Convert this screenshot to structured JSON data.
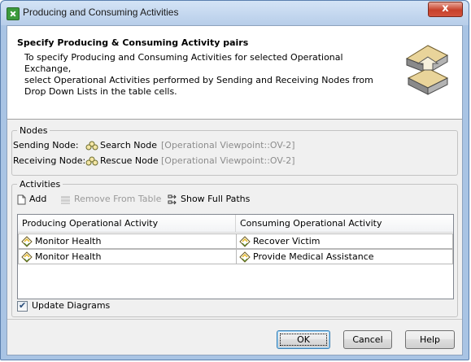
{
  "window": {
    "title": "Producing and Consuming Activities",
    "close_label": "x"
  },
  "header": {
    "title": "Specify Producing & Consuming Activity pairs",
    "description_lines": [
      "To specify Producing and Consuming Activities for selected Operational Exchange,",
      "select Operational Activities performed by Sending and Receiving Nodes from",
      "Drop Down Lists in the table cells."
    ]
  },
  "nodes": {
    "group_label": "Nodes",
    "sending": {
      "label": "Sending Node:",
      "name": "Search Node",
      "qualifier": "[Operational Viewpoint::OV-2]",
      "icon": "node-icon"
    },
    "receiving": {
      "label": "Receiving Node:",
      "name": "Rescue Node",
      "qualifier": "[Operational Viewpoint::OV-2]",
      "icon": "node-icon"
    }
  },
  "activities": {
    "group_label": "Activities",
    "toolbar": {
      "add": "Add",
      "remove": "Remove From Table",
      "show_full_paths": "Show Full Paths"
    },
    "columns": [
      "Producing Operational Activity",
      "Consuming Operational Activity"
    ],
    "rows": [
      {
        "producing": "Monitor Health",
        "consuming": "Recover Victim"
      },
      {
        "producing": "Monitor Health",
        "consuming": "Provide Medical Assistance"
      }
    ]
  },
  "update_diagrams": {
    "label": "Update Diagrams",
    "checked": true
  },
  "buttons": {
    "ok": "OK",
    "cancel": "Cancel",
    "help": "Help"
  },
  "colors": {
    "title_bar": "#bcd3ec",
    "close_button": "#c7412b",
    "activity_icon": "#e8b923"
  }
}
